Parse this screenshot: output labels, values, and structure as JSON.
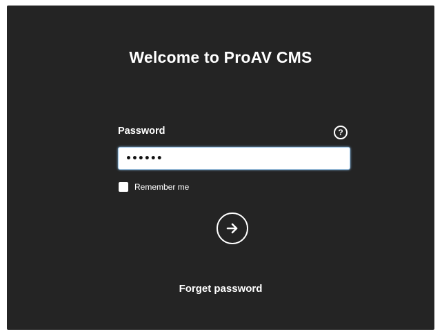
{
  "title": "Welcome to ProAV CMS",
  "password": {
    "label": "Password",
    "value": "••••••",
    "help_glyph": "?",
    "help_icon": "question-circle-icon"
  },
  "remember": {
    "label": "Remember me",
    "checked": false
  },
  "submit": {
    "icon": "arrow-right-circle-icon"
  },
  "forget_label": "Forget password",
  "colors": {
    "panel_bg": "#242424",
    "text": "#ffffff",
    "input_focus_border": "#9fc7e8"
  }
}
